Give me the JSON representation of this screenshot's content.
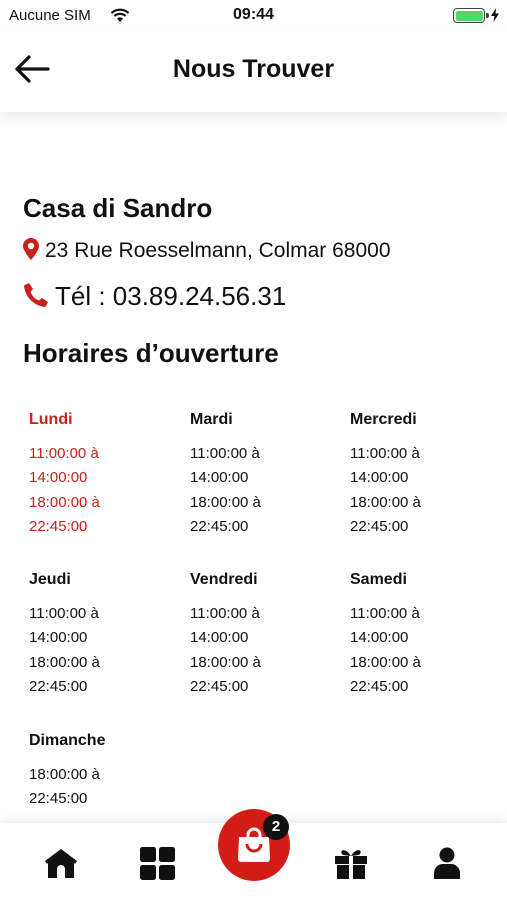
{
  "status_bar": {
    "carrier": "Aucune SIM",
    "time": "09:44",
    "battery_level": 1.0
  },
  "header": {
    "title": "Nous Trouver"
  },
  "restaurant": {
    "name": "Casa di Sandro",
    "address": "23 Rue Roesselmann, Colmar 68000",
    "phone": "Tél : 03.89.24.56.31"
  },
  "hours": {
    "title": "Horaires d’ouverture",
    "days": [
      {
        "name": "Lundi",
        "lines": [
          "11:00:00 à",
          "14:00:00",
          "18:00:00 à",
          "22:45:00"
        ]
      },
      {
        "name": "Mardi",
        "lines": [
          "11:00:00 à",
          "14:00:00",
          "18:00:00 à",
          "22:45:00"
        ]
      },
      {
        "name": "Mercredi",
        "lines": [
          "11:00:00 à",
          "14:00:00",
          "18:00:00 à",
          "22:45:00"
        ]
      },
      {
        "name": "Jeudi",
        "lines": [
          "11:00:00 à",
          "14:00:00",
          "18:00:00 à",
          "22:45:00"
        ]
      },
      {
        "name": "Vendredi",
        "lines": [
          "11:00:00 à",
          "14:00:00",
          "18:00:00 à",
          "22:45:00"
        ]
      },
      {
        "name": "Samedi",
        "lines": [
          "11:00:00 à",
          "14:00:00",
          "18:00:00 à",
          "22:45:00"
        ]
      },
      {
        "name": "Dimanche",
        "lines": [
          "18:00:00 à",
          "22:45:00"
        ]
      }
    ]
  },
  "bottom_nav": {
    "cart_count": "2",
    "icons": [
      "home-icon",
      "grid-icon",
      "shopping-bag-icon",
      "gift-icon",
      "user-icon"
    ]
  },
  "colors": {
    "accent": "#c8201b",
    "cart_button": "#d21d17",
    "battery": "#4cd964"
  }
}
